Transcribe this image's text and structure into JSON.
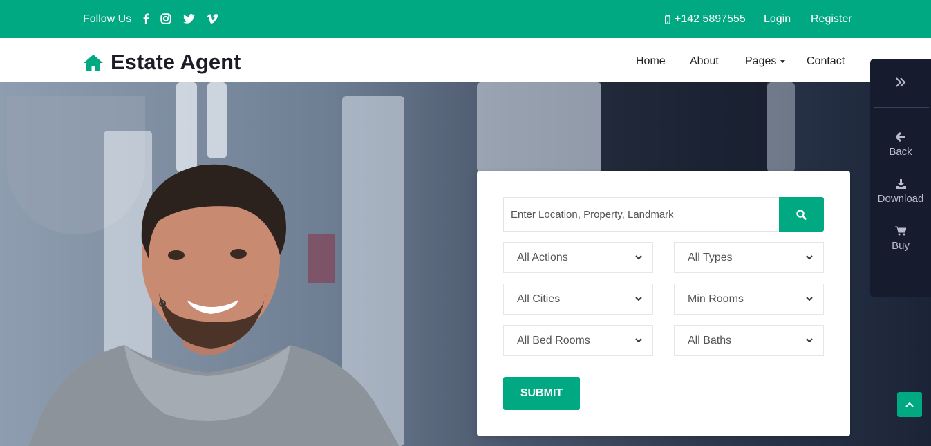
{
  "topbar": {
    "follow_label": "Follow Us",
    "social": [
      "facebook-icon",
      "instagram-icon",
      "twitter-icon",
      "vimeo-icon"
    ],
    "phone": "+142 5897555",
    "login": "Login",
    "register": "Register"
  },
  "brand": {
    "name": "Estate Agent",
    "icon": "home-icon"
  },
  "nav": {
    "home": "Home",
    "about": "About",
    "pages": "Pages",
    "contact": "Contact"
  },
  "search": {
    "placeholder": "Enter Location, Property, Landmark",
    "button_icon": "search-icon"
  },
  "filters": {
    "actions": "All Actions",
    "types": "All Types",
    "cities": "All Cities",
    "min_rooms": "Min Rooms",
    "bed_rooms": "All Bed Rooms",
    "baths": "All Baths"
  },
  "submit_label": "SUBMIT",
  "side_panel": {
    "toggle_icon": "double-chevron-right-icon",
    "back": "Back",
    "download": "Download",
    "buy": "Buy"
  },
  "colors": {
    "accent": "#00a982",
    "side_panel": "#171b2e",
    "text_dark": "#1c1c28"
  }
}
